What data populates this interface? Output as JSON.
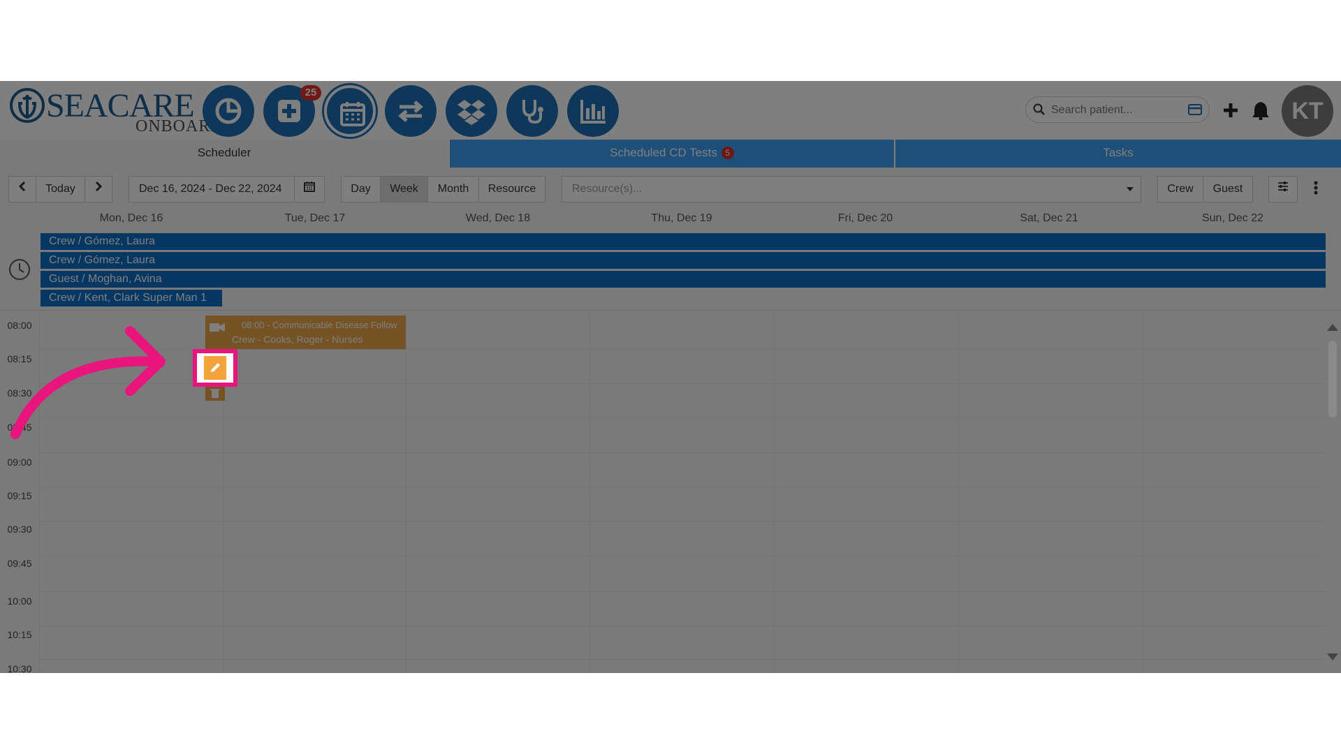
{
  "brand": {
    "name_top": "SEACARE",
    "name_bottom": "ONBOARD"
  },
  "nav": {
    "items": [
      {
        "name": "dashboard",
        "icon": "pie-chart-icon"
      },
      {
        "name": "add-record",
        "icon": "plus-square-icon",
        "badge": "25"
      },
      {
        "name": "scheduler",
        "icon": "calendar-icon"
      },
      {
        "name": "transfers",
        "icon": "exchange-icon"
      },
      {
        "name": "inventory",
        "icon": "dropbox-icon"
      },
      {
        "name": "medical",
        "icon": "stethoscope-icon"
      },
      {
        "name": "reports",
        "icon": "bar-chart-icon"
      }
    ],
    "badge": "25"
  },
  "search": {
    "placeholder": "Search patient..."
  },
  "user": {
    "initials": "KT"
  },
  "tabs": {
    "scheduler": "Scheduler",
    "cd_tests": "Scheduled CD Tests",
    "cd_tests_count": "5",
    "tasks": "Tasks"
  },
  "toolbar": {
    "today": "Today",
    "date_range": "Dec 16, 2024 - Dec 22, 2024",
    "views": {
      "day": "Day",
      "week": "Week",
      "month": "Month",
      "resource": "Resource"
    },
    "resource_placeholder": "Resource(s)...",
    "crew": "Crew",
    "guest": "Guest"
  },
  "days": [
    "Mon, Dec 16",
    "Tue, Dec 17",
    "Wed, Dec 18",
    "Thu, Dec 19",
    "Fri, Dec 20",
    "Sat, Dec 21",
    "Sun, Dec 22"
  ],
  "allday": [
    "Crew / Gómez, Laura",
    "Crew / Gómez, Laura",
    "Guest / Moghan, Avina",
    "Crew / Kent, Clark Super Man 1"
  ],
  "times": [
    "08:00",
    "08:15",
    "08:30",
    "08:45",
    "09:00",
    "09:15",
    "09:30",
    "09:45",
    "10:00",
    "10:15",
    "10:30"
  ],
  "event": {
    "title": "08:00 - Communicable Disease Follow",
    "subtitle": "Crew - Cooks, Roger - Nurses"
  },
  "colors": {
    "primary": "#1f6fb5",
    "event": "#eaa74a",
    "highlight": "#e8157d"
  }
}
